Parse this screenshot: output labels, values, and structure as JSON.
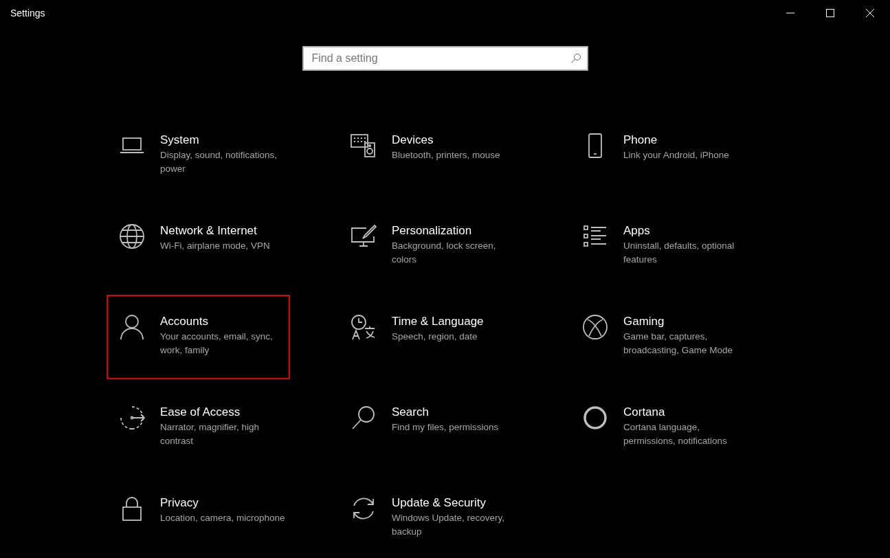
{
  "window": {
    "title": "Settings"
  },
  "search": {
    "placeholder": "Find a setting"
  },
  "tiles": [
    {
      "title": "System",
      "description": "Display, sound, notifications, power",
      "highlighted": false
    },
    {
      "title": "Devices",
      "description": "Bluetooth, printers, mouse",
      "highlighted": false
    },
    {
      "title": "Phone",
      "description": "Link your Android, iPhone",
      "highlighted": false
    },
    {
      "title": "Network & Internet",
      "description": "Wi-Fi, airplane mode, VPN",
      "highlighted": false
    },
    {
      "title": "Personalization",
      "description": "Background, lock screen, colors",
      "highlighted": false
    },
    {
      "title": "Apps",
      "description": "Uninstall, defaults, optional features",
      "highlighted": false
    },
    {
      "title": "Accounts",
      "description": "Your accounts, email, sync, work, family",
      "highlighted": true
    },
    {
      "title": "Time & Language",
      "description": "Speech, region, date",
      "highlighted": false
    },
    {
      "title": "Gaming",
      "description": "Game bar, captures, broadcasting, Game Mode",
      "highlighted": false
    },
    {
      "title": "Ease of Access",
      "description": "Narrator, magnifier, high contrast",
      "highlighted": false
    },
    {
      "title": "Search",
      "description": "Find my files, permissions",
      "highlighted": false
    },
    {
      "title": "Cortana",
      "description": "Cortana language, permissions, notifications",
      "highlighted": false
    },
    {
      "title": "Privacy",
      "description": "Location, camera, microphone",
      "highlighted": false
    },
    {
      "title": "Update & Security",
      "description": "Windows Update, recovery, backup",
      "highlighted": false
    }
  ]
}
